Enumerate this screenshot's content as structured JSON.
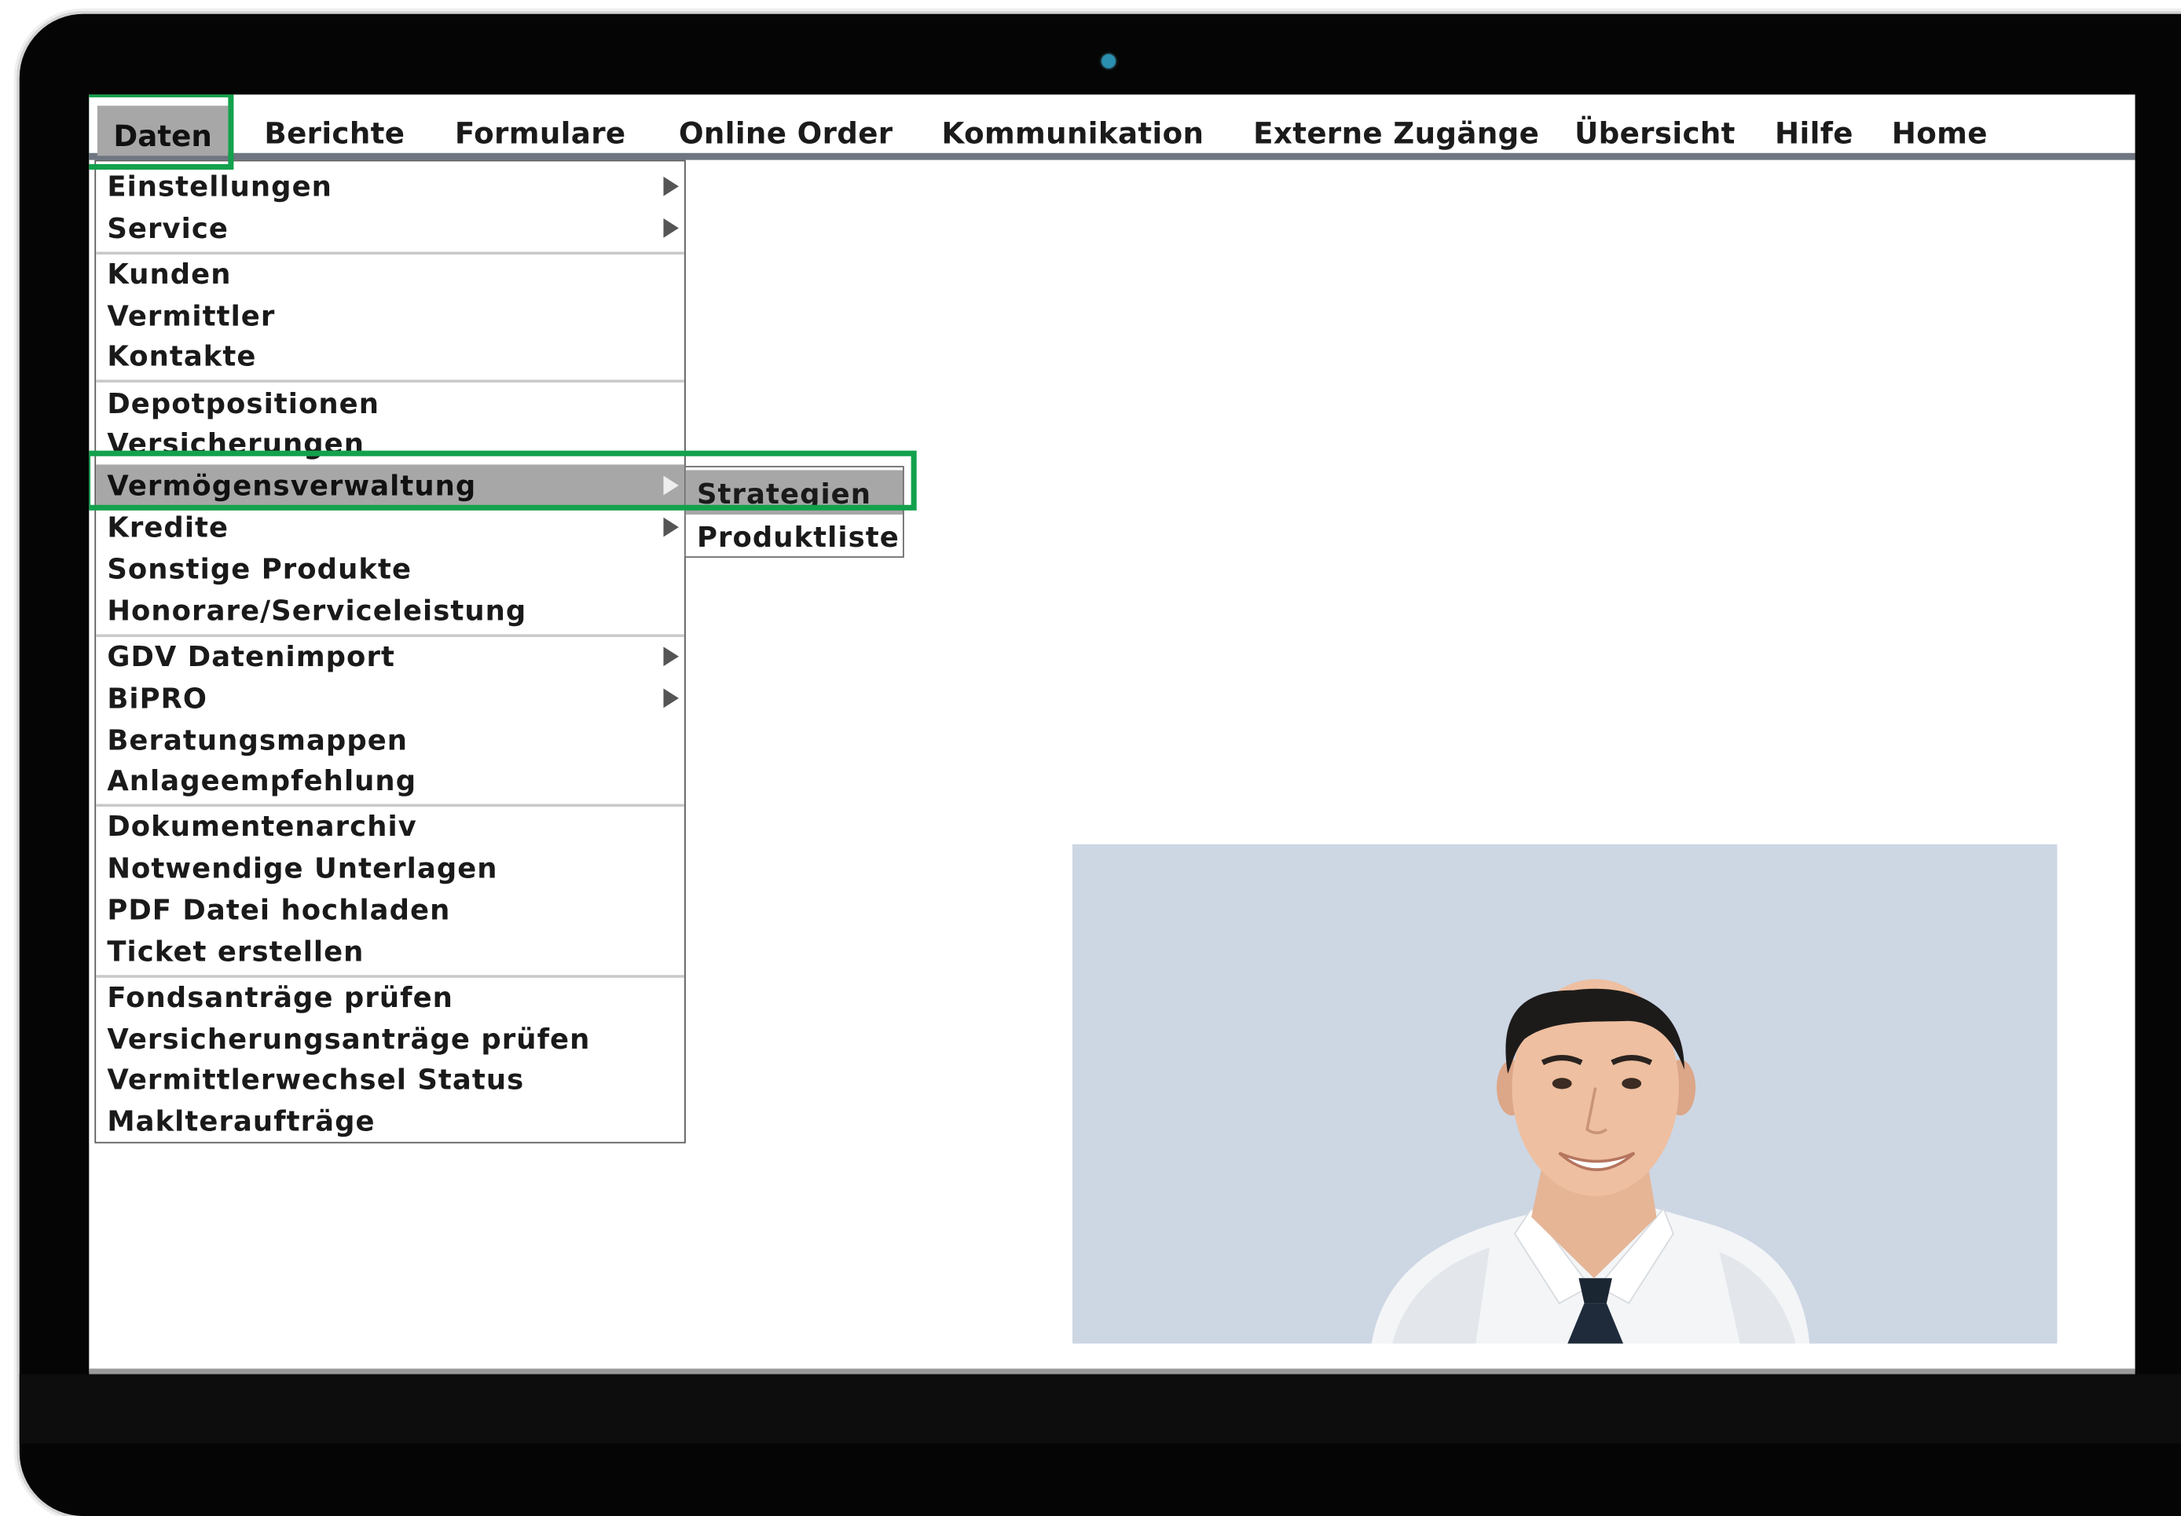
{
  "menubar": {
    "items": [
      "Daten",
      "Berichte",
      "Formulare",
      "Online Order",
      "Kommunikation",
      "Externe Zugänge",
      "Übersicht",
      "Hilfe",
      "Home"
    ],
    "active": "Daten"
  },
  "dropdown": {
    "groups": [
      [
        {
          "label": "Einstellungen",
          "submenu": true
        },
        {
          "label": "Service",
          "submenu": true
        }
      ],
      [
        {
          "label": "Kunden"
        },
        {
          "label": "Vermittler"
        },
        {
          "label": "Kontakte"
        }
      ],
      [
        {
          "label": "Depotpositionen"
        },
        {
          "label": "Versicherungen"
        },
        {
          "label": "Vermögensverwaltung",
          "submenu": true,
          "active": true
        },
        {
          "label": "Kredite",
          "submenu": true
        },
        {
          "label": "Sonstige Produkte"
        },
        {
          "label": "Honorare/Serviceleistung"
        }
      ],
      [
        {
          "label": "GDV Datenimport",
          "submenu": true
        },
        {
          "label": "BiPRO",
          "submenu": true
        },
        {
          "label": "Beratungsmappen"
        },
        {
          "label": "Anlageempfehlung"
        }
      ],
      [
        {
          "label": "Dokumentenarchiv"
        },
        {
          "label": "Notwendige Unterlagen"
        },
        {
          "label": "PDF Datei hochladen"
        },
        {
          "label": "Ticket erstellen"
        }
      ],
      [
        {
          "label": "Fondsanträge prüfen"
        },
        {
          "label": "Versicherungsanträge prüfen"
        },
        {
          "label": "Vermittlerwechsel Status"
        },
        {
          "label": "Maklteraufträge"
        }
      ]
    ]
  },
  "submenu": {
    "items": [
      "Strategien",
      "Produktliste"
    ],
    "active": "Strategien"
  },
  "colors": {
    "highlight_border": "#13a14d",
    "active_item_bg": "#a7a7a7",
    "menubar_rule": "#6f7682",
    "photo_background": "#cdd6e3"
  }
}
